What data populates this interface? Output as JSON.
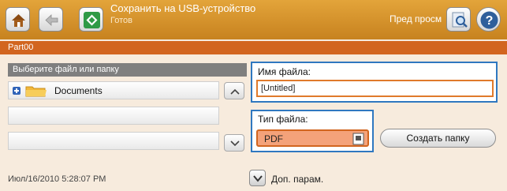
{
  "header": {
    "title": "Сохранить на USB-устройство",
    "status": "Готов",
    "preview_label": "Пред просм",
    "icons": [
      "home-icon",
      "back-icon",
      "start-icon",
      "preview-icon",
      "help-icon"
    ]
  },
  "breadcrumb": {
    "label": "Part00"
  },
  "file_list": {
    "header": "Выберите файл или папку",
    "items": [
      {
        "label": "Documents",
        "icon": "folder-icon",
        "expand_icon": "plus-icon"
      },
      {
        "label": ""
      },
      {
        "label": ""
      }
    ]
  },
  "file_name": {
    "label": "Имя файла:",
    "value": "[Untitled]"
  },
  "file_type": {
    "label": "Тип файла:",
    "value": "PDF"
  },
  "buttons": {
    "create_folder": "Создать папку",
    "more_options": "Доп. парам."
  },
  "footer": {
    "timestamp": "Июл/16/2010 5:28:07 PM"
  },
  "colors": {
    "header": "#d48f2a",
    "band": "#d2651f",
    "focus_border": "#2f78c0",
    "background": "#f7ebdd"
  }
}
